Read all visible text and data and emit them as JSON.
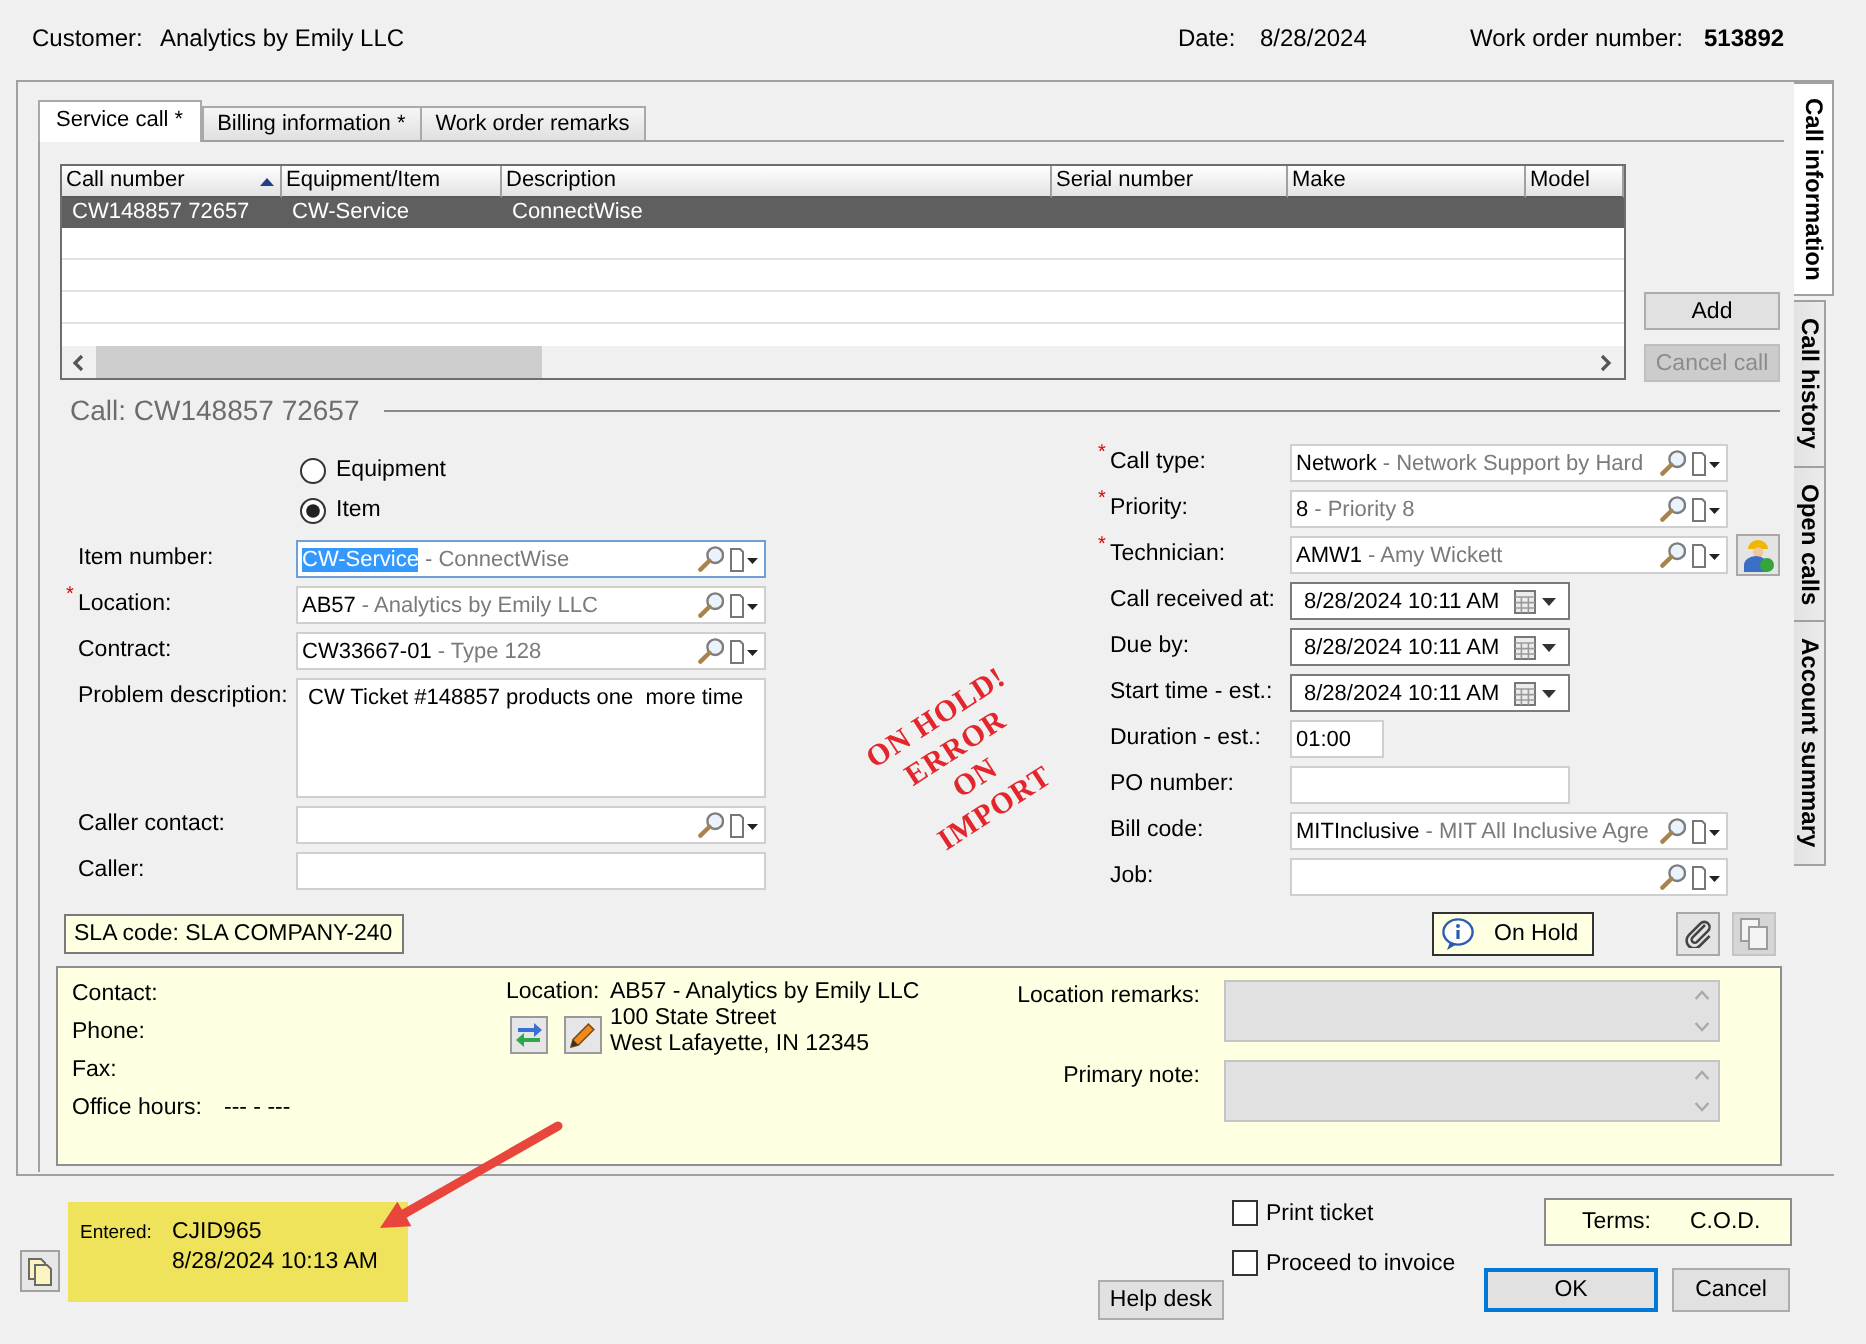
{
  "header": {
    "customer_label": "Customer:",
    "customer": "Analytics by Emily LLC",
    "date_label": "Date:",
    "date": "8/28/2024",
    "work_order_label": "Work order number:",
    "work_order_number": "513892"
  },
  "tabs": [
    {
      "label": "Service call *",
      "selected": true
    },
    {
      "label": "Billing information *",
      "selected": false
    },
    {
      "label": "Work order remarks",
      "selected": false
    }
  ],
  "side_tabs": [
    {
      "label": "Call information",
      "selected": true
    },
    {
      "label": "Call history",
      "selected": false
    },
    {
      "label": "Open calls",
      "selected": false
    },
    {
      "label": "Account summary",
      "selected": false
    }
  ],
  "calls_table": {
    "columns": [
      {
        "label": "Call number",
        "sorted": true
      },
      {
        "label": "Equipment/Item",
        "sorted": false
      },
      {
        "label": "Description",
        "sorted": false
      },
      {
        "label": "Serial number",
        "sorted": false
      },
      {
        "label": "Make",
        "sorted": false
      },
      {
        "label": "Model",
        "sorted": false
      }
    ],
    "rows": [
      {
        "cells": [
          "CW148857 72657",
          "CW-Service",
          "ConnectWise"
        ],
        "selected": true
      }
    ]
  },
  "call_buttons": [
    {
      "label": "Add",
      "disabled": false
    },
    {
      "label": "Cancel call",
      "disabled": true
    }
  ],
  "call_title": "Call: CW148857 72657",
  "target_options": [
    {
      "label": "Equipment",
      "selected": false
    },
    {
      "label": "Item",
      "selected": true
    }
  ],
  "left_fields": [
    {
      "kind": "lookup",
      "label": "Item number:",
      "code": "CW-Service",
      "description": "- ConnectWise",
      "focused": true
    },
    {
      "kind": "lookup",
      "label": "Location:",
      "required_mark": "*",
      "code": "AB57",
      "description": "- Analytics by Emily LLC",
      "focused": false
    },
    {
      "kind": "lookup",
      "label": "Contract:",
      "code": "CW33667-01",
      "description": "- Type 128",
      "focused": false
    },
    {
      "kind": "textarea",
      "label": "Problem description:",
      "value": "CW Ticket #148857 products one  more time"
    },
    {
      "kind": "lookup",
      "label": "Caller contact:",
      "focused": false
    },
    {
      "kind": "text",
      "label": "Caller:"
    }
  ],
  "right_fields": [
    {
      "kind": "lookup",
      "label": "Call type:",
      "required_mark": "*",
      "code": "Network",
      "description": "- Network Support by Hard",
      "focused": false,
      "assign_button": false
    },
    {
      "kind": "lookup",
      "label": "Priority:",
      "required_mark": "*",
      "code": "8",
      "description": "- Priority 8",
      "focused": false,
      "assign_button": false
    },
    {
      "kind": "lookup",
      "label": "Technician:",
      "required_mark": "*",
      "code": "AMW1",
      "description": "- Amy Wickett",
      "focused": false,
      "assign_button": true
    },
    {
      "kind": "date",
      "label": "Call received at:",
      "value": "8/28/2024 10:11 AM"
    },
    {
      "kind": "date",
      "label": "Due by:",
      "value": "8/28/2024 10:11 AM"
    },
    {
      "kind": "date",
      "label": "Start time - est.:",
      "value": "8/28/2024 10:11 AM"
    },
    {
      "kind": "duration",
      "label": "Duration - est.:",
      "value": "01:00"
    },
    {
      "kind": "text",
      "label": "PO number:"
    },
    {
      "kind": "lookup",
      "label": "Bill code:",
      "code": "MITInclusive",
      "description": "- MIT All Inclusive Agre",
      "focused": false,
      "assign_button": false
    },
    {
      "kind": "lookup",
      "label": "Job:",
      "focused": false,
      "assign_button": false
    }
  ],
  "stamp": {
    "lines": [
      "ON HOLD!",
      "ERROR",
      "ON",
      "IMPORT"
    ]
  },
  "sla_code": "SLA code: SLA COMPANY-240",
  "on_hold_button": "On Hold",
  "icon_buttons": [
    {
      "kind": "attach",
      "disabled": false
    },
    {
      "kind": "copy",
      "disabled": true
    }
  ],
  "contact_info": {
    "rows": [
      {
        "label": "Contact:"
      },
      {
        "label": "Phone:"
      },
      {
        "label": "Fax:"
      },
      {
        "label": "Office hours:",
        "value": "--- - ---"
      }
    ],
    "location_label": "Location:",
    "address": [
      "AB57 - Analytics by Emily LLC",
      "100 State Street",
      "West Lafayette, IN 12345"
    ],
    "remarks": [
      {
        "label": "Location remarks:",
        "disabled": true
      },
      {
        "label": "Primary note:",
        "disabled": true
      }
    ]
  },
  "entered": {
    "label": "Entered:",
    "by": "CJID965",
    "time": "8/28/2024 10:13 AM"
  },
  "options": [
    {
      "label": "Print ticket",
      "checked": false
    },
    {
      "label": "Proceed to invoice",
      "checked": false
    }
  ],
  "help_desk_button": "Help desk",
  "terms": {
    "label": "Terms:",
    "value": "C.O.D."
  },
  "dialog_buttons": [
    {
      "label": "OK",
      "default": true
    },
    {
      "label": "Cancel",
      "default": false
    }
  ]
}
